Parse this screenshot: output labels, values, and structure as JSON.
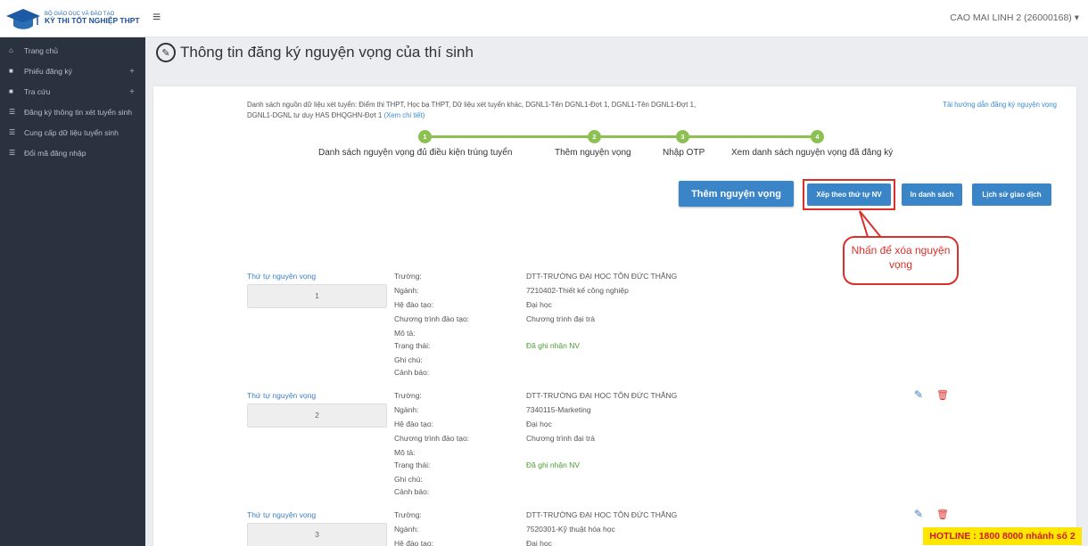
{
  "brand": {
    "line1": "BỘ GIÁO DỤC VÀ ĐÀO TẠO",
    "line2": "KỲ THI TỐT NGHIỆP THPT"
  },
  "sidebar": {
    "items": [
      {
        "label": "Trang chủ",
        "icon": "home-icon",
        "has_plus": false
      },
      {
        "label": "Phiếu đăng ký",
        "icon": "folder-icon",
        "has_plus": true
      },
      {
        "label": "Tra cứu",
        "icon": "folder-icon",
        "has_plus": true
      },
      {
        "label": "Đăng ký thông tin xét tuyển sinh",
        "icon": "list-icon",
        "has_plus": false
      },
      {
        "label": "Cung cấp dữ liệu tuyển sinh",
        "icon": "list-icon",
        "has_plus": false
      },
      {
        "label": "Đổi mã đăng nhập",
        "icon": "list-icon",
        "has_plus": false
      }
    ],
    "plus": "+"
  },
  "header": {
    "user": "CAO MAI LINH 2 (26000168)",
    "menu_glyph": "≡"
  },
  "page": {
    "title": "Thông tin đăng ký nguyện vọng của thí sinh",
    "title_glyph": "✎"
  },
  "source": {
    "text": "Danh sách nguồn dữ liệu xét tuyển: Điểm thi THPT, Học bạ THPT, Dữ liệu xét tuyển khác, DGNL1-Tên DGNL1-Đợt 1, DGNL1-Tên DGNL1-Đợt 1, DGNL1-DGNL tư duy HAS ĐHQGHN-Đợt 1",
    "detail_link": "(Xem chi tiết)",
    "guide_link": "Tải hướng dẫn đăng ký nguyện vọng"
  },
  "steps": [
    {
      "num": "1",
      "label": "Danh sách nguyện vọng đủ điều kiện trúng tuyển"
    },
    {
      "num": "2",
      "label": "Thêm nguyện vọng"
    },
    {
      "num": "3",
      "label": "Nhập OTP"
    },
    {
      "num": "4",
      "label": "Xem danh sách nguyện vọng đã đăng ký"
    }
  ],
  "buttons": {
    "add": "Thêm nguyện vọng",
    "sort": "Xếp theo thứ tự NV",
    "print": "In danh sách",
    "history": "Lịch sử giao dịch"
  },
  "callout": "Nhấn để xóa nguyện vọng",
  "field_labels": {
    "order": "Thứ tự nguyện vọng",
    "school": "Trường:",
    "major": "Ngành:",
    "level": "Hệ đào tạo:",
    "program": "Chương trình đào tạo:",
    "desc": "Mô tả:",
    "status": "Trạng thái:",
    "note": "Ghi chú:",
    "warning": "Cảnh báo:"
  },
  "items": [
    {
      "order": "1",
      "school": "DTT-TRƯỜNG ĐẠI HỌC TÔN ĐỨC THẮNG",
      "major": "7210402-Thiết kế công nghiệp",
      "level": "Đại học",
      "program": "Chương trình đại trà",
      "status": "Đã ghi nhận NV"
    },
    {
      "order": "2",
      "school": "DTT-TRƯỜNG ĐẠI HỌC TÔN ĐỨC THẮNG",
      "major": "7340115-Marketing",
      "level": "Đại học",
      "program": "Chương trình đại trà",
      "status": "Đã ghi nhận NV"
    },
    {
      "order": "3",
      "school": "DTT-TRƯỜNG ĐẠI HỌC TÔN ĐỨC THẮNG",
      "major": "7520301-Kỹ thuật hóa học",
      "level": "Đại học",
      "program": "",
      "status": ""
    }
  ],
  "icons": {
    "edit": "✎",
    "delete": "🗑"
  },
  "hotline": "HOTLINE : 1800 8000 nhánh số 2",
  "colors": {
    "sidebar": "#2a3240",
    "accent": "#3a85c8",
    "step": "#8cc152",
    "highlight": "#d9302c",
    "hotline_bg": "#ffe600"
  }
}
